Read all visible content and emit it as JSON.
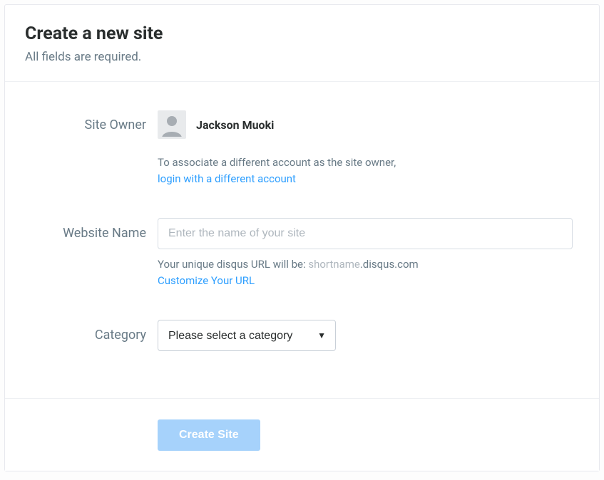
{
  "header": {
    "title": "Create a new site",
    "subtitle": "All fields are required."
  },
  "site_owner": {
    "label": "Site Owner",
    "name": "Jackson Muoki",
    "help_text": "To associate a different account as the site owner,",
    "login_link": "login with a different account"
  },
  "website_name": {
    "label": "Website Name",
    "placeholder": "Enter the name of your site",
    "value": "",
    "url_help_prefix": "Your unique disqus URL will be: ",
    "url_help_shortname": "shortname",
    "url_help_suffix": ".disqus.com",
    "customize_link": "Customize Your URL"
  },
  "category": {
    "label": "Category",
    "selected": "Please select a category"
  },
  "footer": {
    "create_label": "Create Site"
  }
}
